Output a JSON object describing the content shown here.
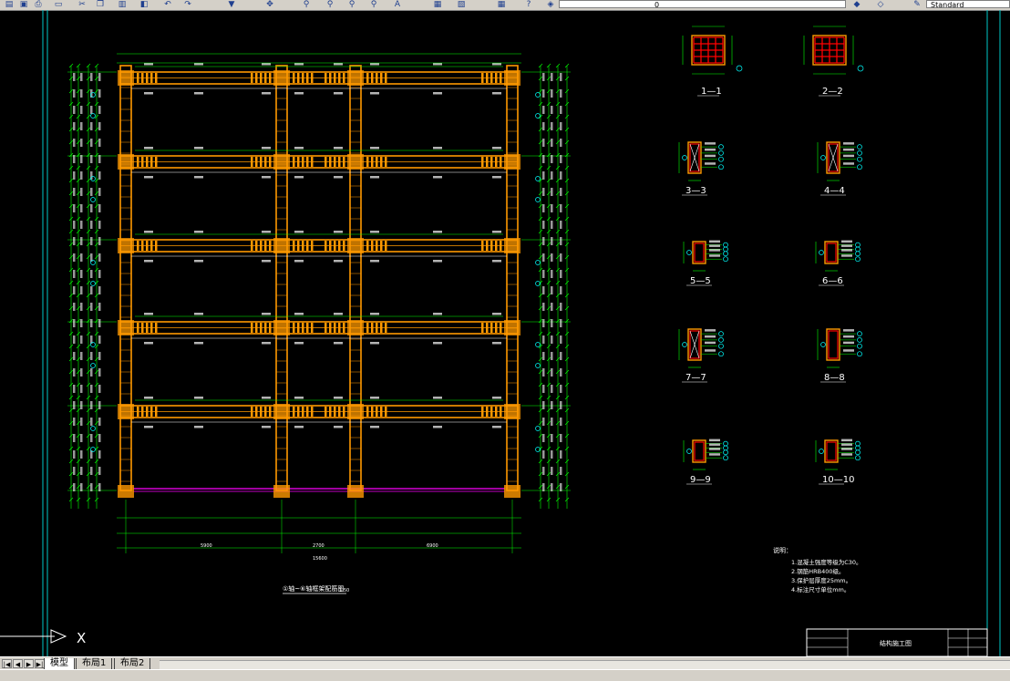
{
  "toolbar": {
    "layer_value": "0",
    "text_style_value": "Standard",
    "icons": [
      "open-icon",
      "save-icon",
      "print-icon",
      "preview-icon",
      "cut-icon",
      "copy-icon",
      "paste-icon",
      "match-icon",
      "undo-icon",
      "redo-icon",
      "pan-icon",
      "zoom-realtime-icon",
      "zoom-window-icon",
      "zoom-previous-icon",
      "text-icon",
      "properties-icon",
      "design-center-icon",
      "tool-palette-icon",
      "calculator-icon",
      "help-icon"
    ]
  },
  "drawing": {
    "elevation_title": "①轴~⑥轴框架配筋图",
    "elevation_scale": "1:50",
    "total_width_label": "15600",
    "span_labels": [
      "5900",
      "2700",
      "6900"
    ],
    "sections": [
      {
        "id": "section-1-1",
        "label": "1—1"
      },
      {
        "id": "section-2-2",
        "label": "2—2"
      },
      {
        "id": "section-3-3",
        "label": "3—3"
      },
      {
        "id": "section-4-4",
        "label": "4—4"
      },
      {
        "id": "section-5-5",
        "label": "5—5"
      },
      {
        "id": "section-6-6",
        "label": "6—6"
      },
      {
        "id": "section-7-7",
        "label": "7—7"
      },
      {
        "id": "section-8-8",
        "label": "8—8"
      },
      {
        "id": "section-9-9",
        "label": "9—9"
      },
      {
        "id": "section-10-10",
        "label": "10—10"
      }
    ],
    "notes_heading": "说明：",
    "notes": [
      "1.混凝土强度等级为C30。",
      "2.钢筋HRB400级。",
      "3.保护层厚度25mm。",
      "4.标注尺寸单位mm。"
    ],
    "title_block_name": "结构施工图",
    "ucs_x_label": "X"
  },
  "layout_tabs": [
    {
      "label": "模型",
      "active": true
    },
    {
      "label": "布局1",
      "active": false
    },
    {
      "label": "布局2",
      "active": false
    }
  ],
  "colors": {
    "beam": "#ff9900",
    "dimension": "#00ff00",
    "rebar": "#ff0000",
    "text": "#ffffff",
    "border": "#00c8c8",
    "leader": "#00ffff",
    "grade_beam": "#ff00ff"
  }
}
